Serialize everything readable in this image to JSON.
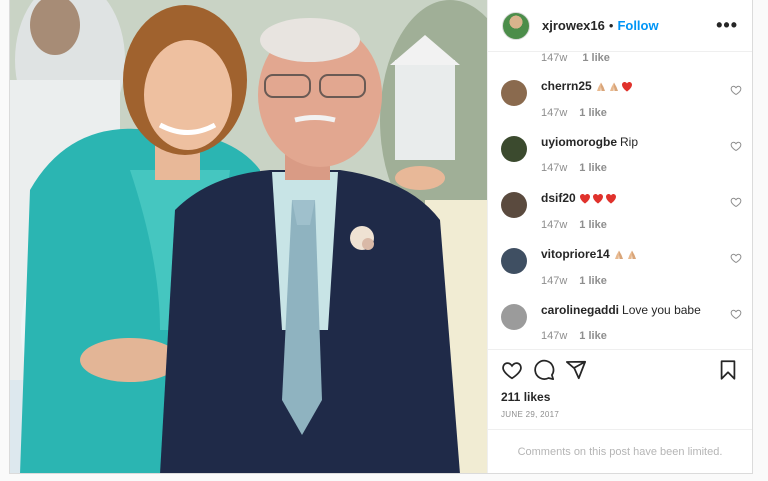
{
  "post": {
    "username": "xjrowex16",
    "follow_label": "Follow",
    "more_label": "•••",
    "separator": "•"
  },
  "top_meta": {
    "time": "147w",
    "likes": "1 like"
  },
  "comments": [
    {
      "username": "cherrn25",
      "text": "",
      "emoji": [
        "folded-hands",
        "folded-hands",
        "heart"
      ],
      "time": "147w",
      "likes": "1 like",
      "avatar_color": "#8a6a4e"
    },
    {
      "username": "uyiomorogbe",
      "text": "Rip",
      "emoji": [],
      "time": "147w",
      "likes": "1 like",
      "avatar_color": "#3b4a2e"
    },
    {
      "username": "dsif20",
      "text": "",
      "emoji": [
        "heart",
        "heart",
        "heart"
      ],
      "time": "147w",
      "likes": "1 like",
      "avatar_color": "#5a4a3e"
    },
    {
      "username": "vitopriore14",
      "text": "",
      "emoji": [
        "folded-hands",
        "folded-hands"
      ],
      "time": "147w",
      "likes": "1 like",
      "avatar_color": "#3f4f62"
    },
    {
      "username": "carolinegaddi",
      "text": "Love you babe",
      "emoji": [],
      "time": "147w",
      "likes": "1 like",
      "avatar_color": "#9b9b9b"
    }
  ],
  "actions": {
    "likes_count": "211 likes",
    "date": "JUNE 29, 2017",
    "comments_limited": "Comments on this post have been limited."
  },
  "icons": {
    "like": "heart-icon",
    "comment": "comment-icon",
    "share": "share-icon",
    "save": "bookmark-icon",
    "more": "more-icon"
  },
  "colors": {
    "accent": "#0095f6",
    "heart": "#ed4956",
    "text": "#262626",
    "muted": "#8e8e8e"
  }
}
